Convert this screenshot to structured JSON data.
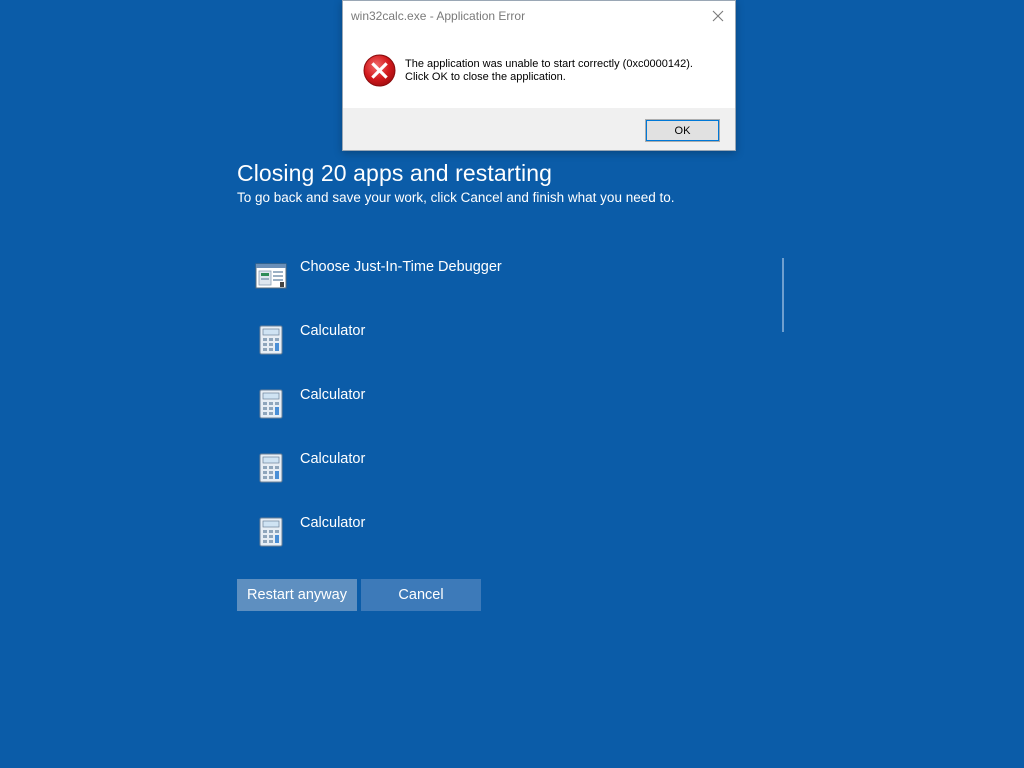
{
  "restart_screen": {
    "title": "Closing 20 apps and restarting",
    "subtitle": "To go back and save your work, click Cancel and finish what you need to.",
    "apps": [
      {
        "name": "Choose Just-In-Time Debugger",
        "icon": "debugger-window-icon"
      },
      {
        "name": "Calculator",
        "icon": "calculator-icon"
      },
      {
        "name": "Calculator",
        "icon": "calculator-icon"
      },
      {
        "name": "Calculator",
        "icon": "calculator-icon"
      },
      {
        "name": "Calculator",
        "icon": "calculator-icon"
      }
    ],
    "restart_button": "Restart anyway",
    "cancel_button": "Cancel"
  },
  "error_dialog": {
    "title": "win32calc.exe - Application Error",
    "message_line1": "The application was unable to start correctly (0xc0000142).",
    "message_line2": "Click OK to close the application.",
    "ok_button": "OK",
    "icon": "error-icon"
  },
  "colors": {
    "background": "#0b5ca8",
    "restart_button": "#5e8fc0",
    "cancel_button": "#3d7ab9",
    "error_red": "#d2191c"
  }
}
